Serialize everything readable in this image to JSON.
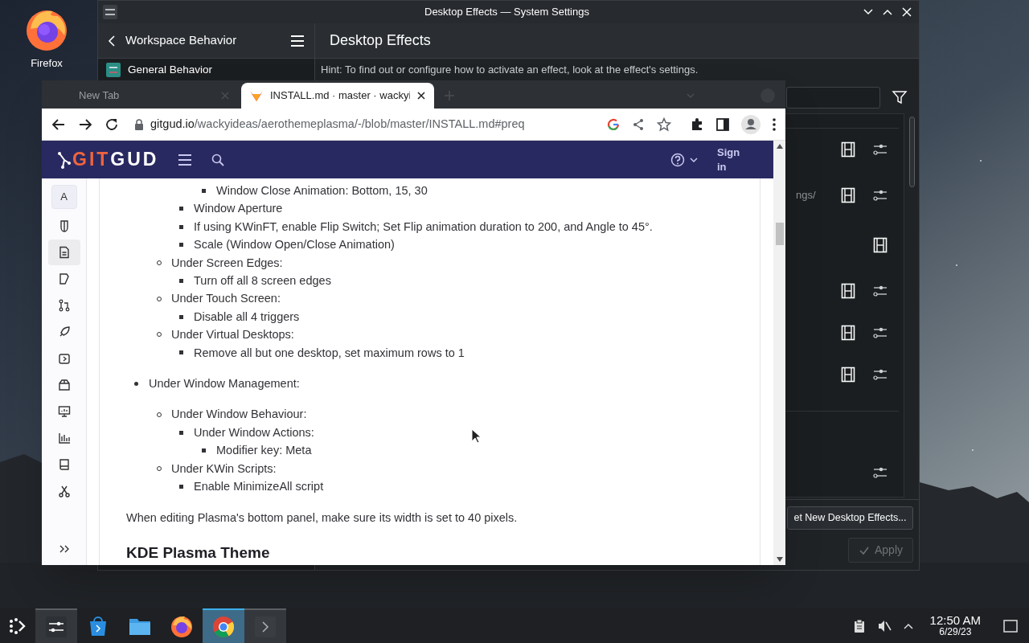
{
  "desktop": {
    "icons": [
      {
        "label": "Firefox"
      }
    ]
  },
  "settings": {
    "title": "Desktop Effects — System Settings",
    "sidebar": {
      "header": "Workspace Behavior",
      "items": [
        {
          "label": "General Behavior"
        }
      ]
    },
    "page": {
      "title": "Desktop Effects",
      "hint": "Hint: To find out or configure how to activate an effect, look at the effect's settings.",
      "effect_groups": [
        [
          {
            "video": true,
            "configure": true
          },
          {
            "description": "ngs/",
            "video": true,
            "configure": true
          },
          {
            "video": true,
            "configure": false
          },
          {
            "video": true,
            "configure": true
          },
          {
            "video": true,
            "configure": true
          },
          {
            "video": true,
            "configure": true
          }
        ],
        [
          {
            "video": false,
            "configure": true
          }
        ]
      ],
      "get_new_button": "et New Desktop Effects...",
      "apply": {
        "label": "Apply",
        "disabled": true
      }
    }
  },
  "browser": {
    "tabs": [
      {
        "title": "New Tab",
        "selected": false
      },
      {
        "title": "INSTALL.md · master · wackyi",
        "selected": true
      }
    ],
    "url": {
      "host": "gitgud.io",
      "path": "/wackyideas/aerothemeplasma/-/blob/master/INSTALL.md#preq"
    },
    "site": {
      "logo": {
        "accent": "GIT",
        "rest": "GUD"
      },
      "sign_in": "Sign in",
      "project_letter": "A",
      "nav": [
        {
          "kind": "shield",
          "selected": false
        },
        {
          "kind": "file",
          "selected": true
        },
        {
          "kind": "issue",
          "selected": false
        },
        {
          "kind": "merge",
          "selected": false
        },
        {
          "kind": "rocket",
          "selected": false
        },
        {
          "kind": "deploy",
          "selected": false
        },
        {
          "kind": "package",
          "selected": false
        },
        {
          "kind": "monitor",
          "selected": false
        },
        {
          "kind": "chart",
          "selected": false
        },
        {
          "kind": "book",
          "selected": false
        },
        {
          "kind": "scissors",
          "selected": false
        }
      ]
    },
    "document": {
      "list": [
        {
          "children": [
            {
              "children": [
                {
                  "children": [
                    {
                      "text": "Window Close Animation: Bottom, 15, 30"
                    }
                  ]
                },
                {
                  "text": "Window Aperture"
                },
                {
                  "text": "If using KWinFT, enable Flip Switch; Set Flip animation duration to 200, and Angle to 45°."
                },
                {
                  "text": "Scale (Window Open/Close Animation)"
                }
              ]
            },
            {
              "text": "Under Screen Edges:",
              "children": [
                {
                  "text": "Turn off all 8 screen edges"
                }
              ]
            },
            {
              "text": "Under Touch Screen:",
              "children": [
                {
                  "text": "Disable all 4 triggers"
                }
              ]
            },
            {
              "text": "Under Virtual Desktops:",
              "children": [
                {
                  "text": "Remove all but one desktop, set maximum rows to 1"
                }
              ]
            }
          ]
        },
        {
          "text": "Under Window Management:",
          "children": [
            {
              "text": "Under Window Behaviour:",
              "children": [
                {
                  "text": "Under Window Actions:",
                  "children": [
                    {
                      "text": "Modifier key: Meta"
                    }
                  ]
                }
              ]
            },
            {
              "text": "Under KWin Scripts:",
              "children": [
                {
                  "text": "Enable MinimizeAll script"
                }
              ]
            }
          ]
        }
      ],
      "paragraph": "When editing Plasma's bottom panel, make sure its width is set to 40 pixels.",
      "heading": "KDE Plasma Theme"
    }
  },
  "taskbar": {
    "tasks": [
      {
        "kind": "settings",
        "open": true,
        "selected": false
      },
      {
        "kind": "store",
        "open": false,
        "selected": false
      },
      {
        "kind": "files",
        "open": false,
        "selected": false
      },
      {
        "kind": "firefox",
        "open": false,
        "selected": false
      },
      {
        "kind": "chrome",
        "open": true,
        "selected": true
      },
      {
        "kind": "terminal",
        "open": true,
        "selected": false
      }
    ],
    "clock": {
      "time": "12:50 AM",
      "date": "6/29/23"
    }
  }
}
